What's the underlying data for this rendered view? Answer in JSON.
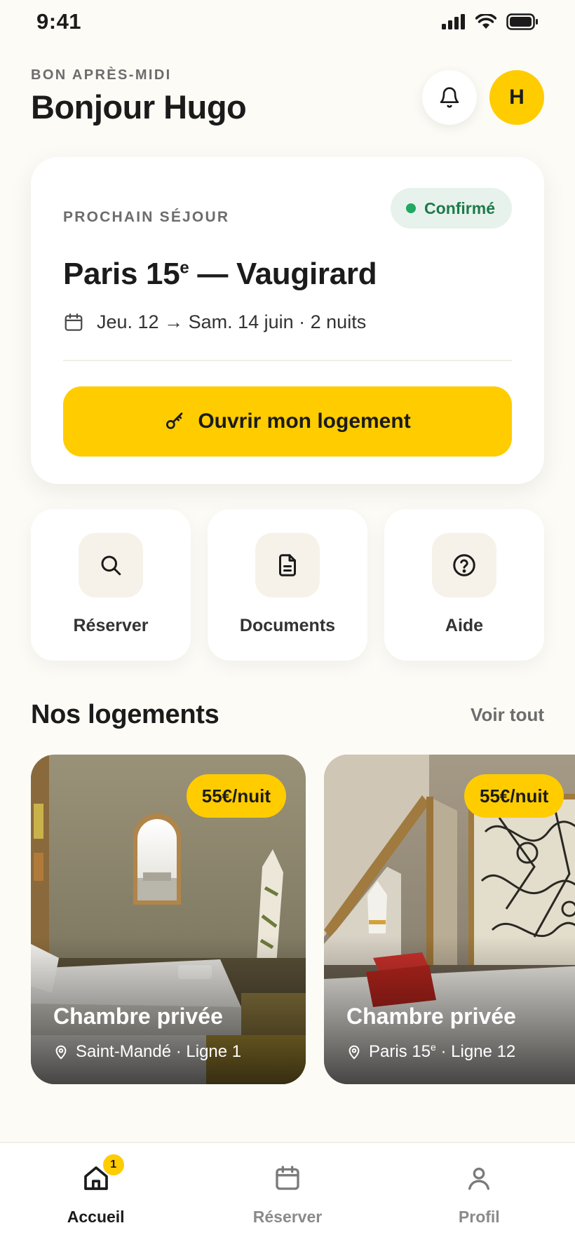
{
  "status_bar": {
    "time": "9:41"
  },
  "header": {
    "greeting_sub": "BON APRÈS-MIDI",
    "greeting_title": "Bonjour Hugo",
    "avatar_initial": "H"
  },
  "stay": {
    "label": "PROCHAIN SÉJOUR",
    "status": "Confirmé",
    "title_main": "Paris 15",
    "title_sup": "e",
    "title_rest": " — Vaugirard",
    "dates": "Jeu. 12 → Sam. 14 juin · 2 nuits",
    "open_button": "Ouvrir mon logement"
  },
  "quick_actions": [
    {
      "label": "Réserver",
      "icon": "search-icon"
    },
    {
      "label": "Documents",
      "icon": "document-icon"
    },
    {
      "label": "Aide",
      "icon": "help-icon"
    }
  ],
  "listings_section": {
    "title": "Nos logements",
    "see_all": "Voir tout",
    "items": [
      {
        "price": "55€/nuit",
        "name": "Chambre privée",
        "location": "Saint-Mandé · Ligne 1"
      },
      {
        "price": "55€/nuit",
        "name": "Chambre privée",
        "location_main": "Paris 15",
        "location_sup": "e",
        "location_rest": " · Ligne 12"
      }
    ]
  },
  "tab_bar": {
    "tabs": [
      {
        "label": "Accueil",
        "icon": "home-icon",
        "badge": "1"
      },
      {
        "label": "Réserver",
        "icon": "calendar-icon"
      },
      {
        "label": "Profil",
        "icon": "user-icon"
      }
    ]
  },
  "colors": {
    "accent": "#ffcc00",
    "background": "#fcfbf6",
    "confirmed_text": "#1d7a4a",
    "confirmed_bg": "#e8f2ec"
  }
}
